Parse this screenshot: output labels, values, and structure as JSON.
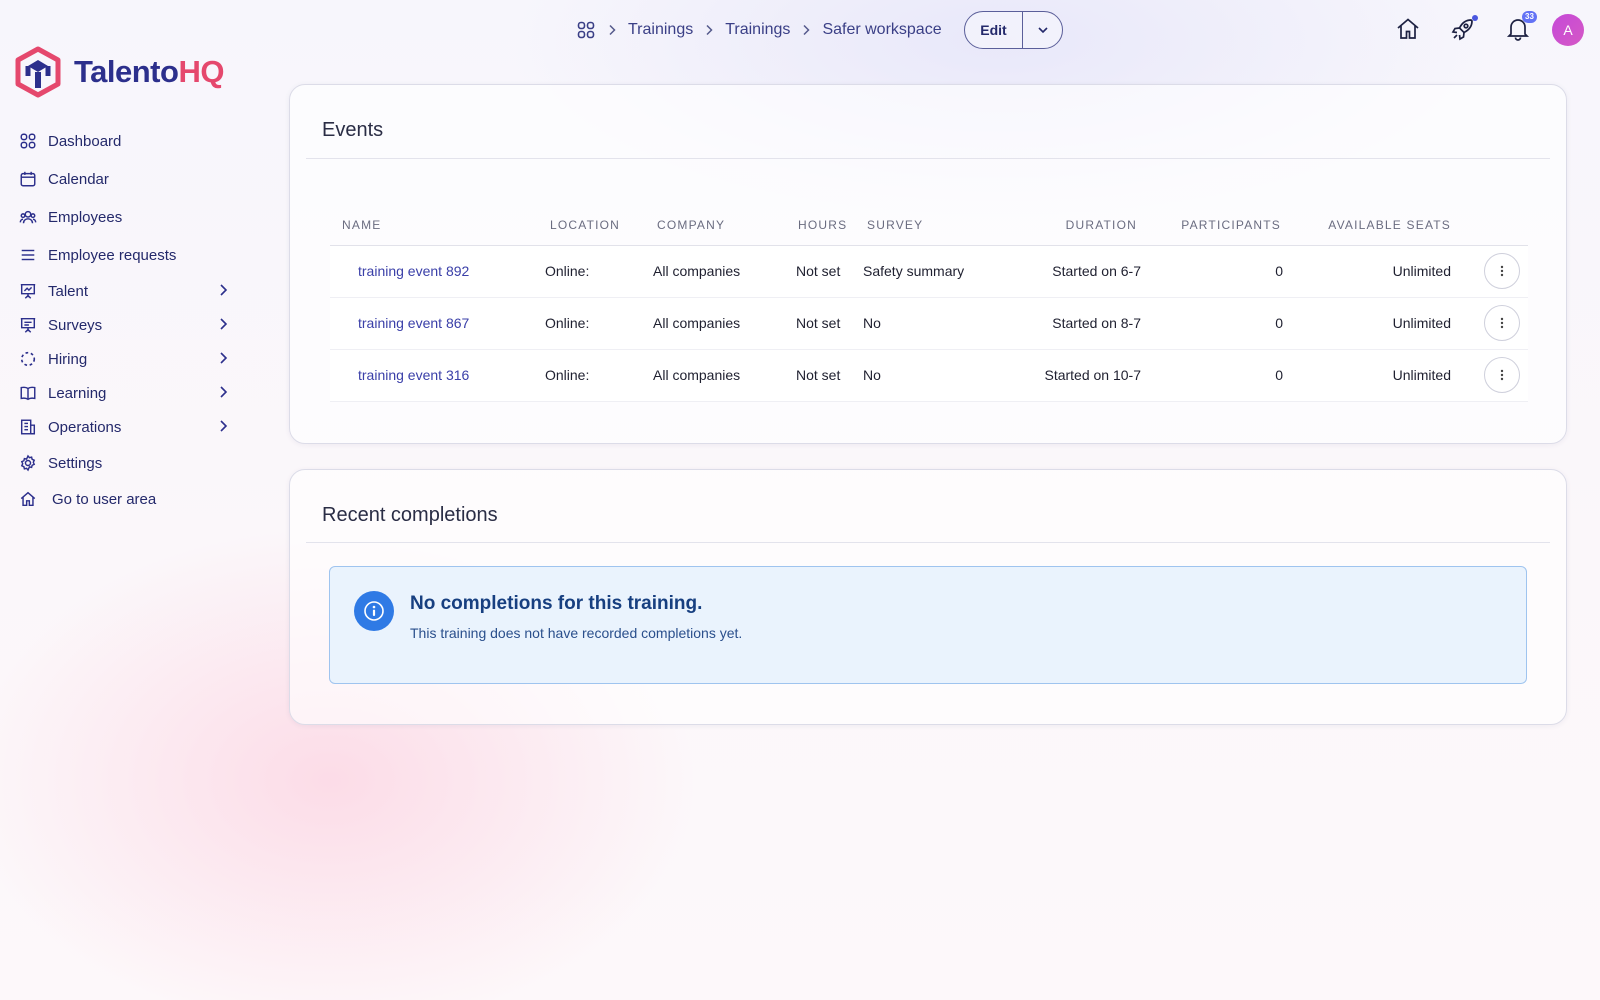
{
  "brand": {
    "name_part1": "Talento",
    "name_part2": "HQ",
    "primary": "#2c2f8c",
    "accent": "#e5486d"
  },
  "sidebar": {
    "items": [
      {
        "label": "Dashboard",
        "icon": "grid-icon",
        "expandable": false
      },
      {
        "label": "Calendar",
        "icon": "calendar-icon",
        "expandable": false
      },
      {
        "label": "Employees",
        "icon": "users-icon",
        "expandable": false
      },
      {
        "label": "Employee requests",
        "icon": "list-icon",
        "expandable": false
      },
      {
        "label": "Talent",
        "icon": "presentation-chart-icon",
        "expandable": true
      },
      {
        "label": "Surveys",
        "icon": "presentation-board-icon",
        "expandable": true
      },
      {
        "label": "Hiring",
        "icon": "dashed-circle-icon",
        "expandable": true
      },
      {
        "label": "Learning",
        "icon": "book-icon",
        "expandable": true
      },
      {
        "label": "Operations",
        "icon": "building-icon",
        "expandable": true
      },
      {
        "label": "Settings",
        "icon": "gear-icon",
        "expandable": false
      },
      {
        "label": "Go to user area",
        "icon": "home-icon",
        "expandable": false
      }
    ]
  },
  "header": {
    "breadcrumb": [
      "Trainings",
      "Trainings",
      "Safer workspace"
    ],
    "edit_label": "Edit",
    "notification_count": "33",
    "avatar_initial": "A"
  },
  "events": {
    "title": "Events",
    "columns": [
      "NAME",
      "LOCATION",
      "COMPANY",
      "HOURS",
      "SURVEY",
      "DURATION",
      "PARTICIPANTS",
      "AVAILABLE SEATS"
    ],
    "rows": [
      {
        "name": "training event 892",
        "location": "Online:",
        "company": "All companies",
        "hours": "Not set",
        "survey": "Safety summary",
        "duration": "Started on 6-7",
        "participants": "0",
        "seats": "Unlimited"
      },
      {
        "name": "training event 867",
        "location": "Online:",
        "company": "All companies",
        "hours": "Not set",
        "survey": "No",
        "duration": "Started on 8-7",
        "participants": "0",
        "seats": "Unlimited"
      },
      {
        "name": "training event 316",
        "location": "Online:",
        "company": "All companies",
        "hours": "Not set",
        "survey": "No",
        "duration": "Started on 10-7",
        "participants": "0",
        "seats": "Unlimited"
      }
    ]
  },
  "completions": {
    "title": "Recent completions",
    "alert_title": "No completions for this training.",
    "alert_text": "This training does not have recorded completions yet."
  }
}
